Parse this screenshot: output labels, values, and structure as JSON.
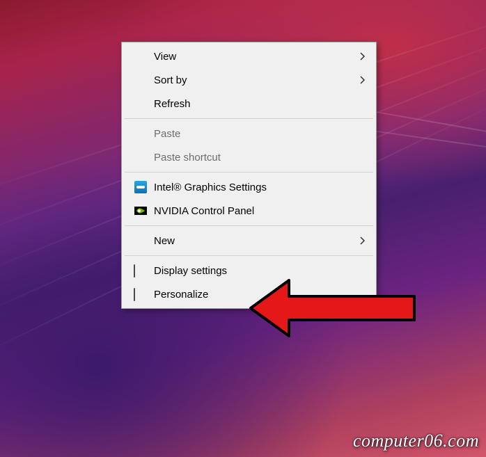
{
  "context_menu": {
    "items": [
      {
        "label": "View",
        "has_submenu": true,
        "enabled": true,
        "icon": null
      },
      {
        "label": "Sort by",
        "has_submenu": true,
        "enabled": true,
        "icon": null
      },
      {
        "label": "Refresh",
        "has_submenu": false,
        "enabled": true,
        "icon": null
      },
      {
        "separator": true
      },
      {
        "label": "Paste",
        "has_submenu": false,
        "enabled": false,
        "icon": null
      },
      {
        "label": "Paste shortcut",
        "has_submenu": false,
        "enabled": false,
        "icon": null
      },
      {
        "separator": true
      },
      {
        "label": "Intel® Graphics Settings",
        "has_submenu": false,
        "enabled": true,
        "icon": "intel"
      },
      {
        "label": "NVIDIA Control Panel",
        "has_submenu": false,
        "enabled": true,
        "icon": "nvidia"
      },
      {
        "separator": true
      },
      {
        "label": "New",
        "has_submenu": true,
        "enabled": true,
        "icon": null
      },
      {
        "separator": true
      },
      {
        "label": "Display settings",
        "has_submenu": false,
        "enabled": true,
        "icon": "display"
      },
      {
        "label": "Personalize",
        "has_submenu": false,
        "enabled": true,
        "icon": "personalize"
      }
    ]
  },
  "watermark": "computer06.com",
  "annotation": {
    "arrow_target": "display-settings"
  }
}
